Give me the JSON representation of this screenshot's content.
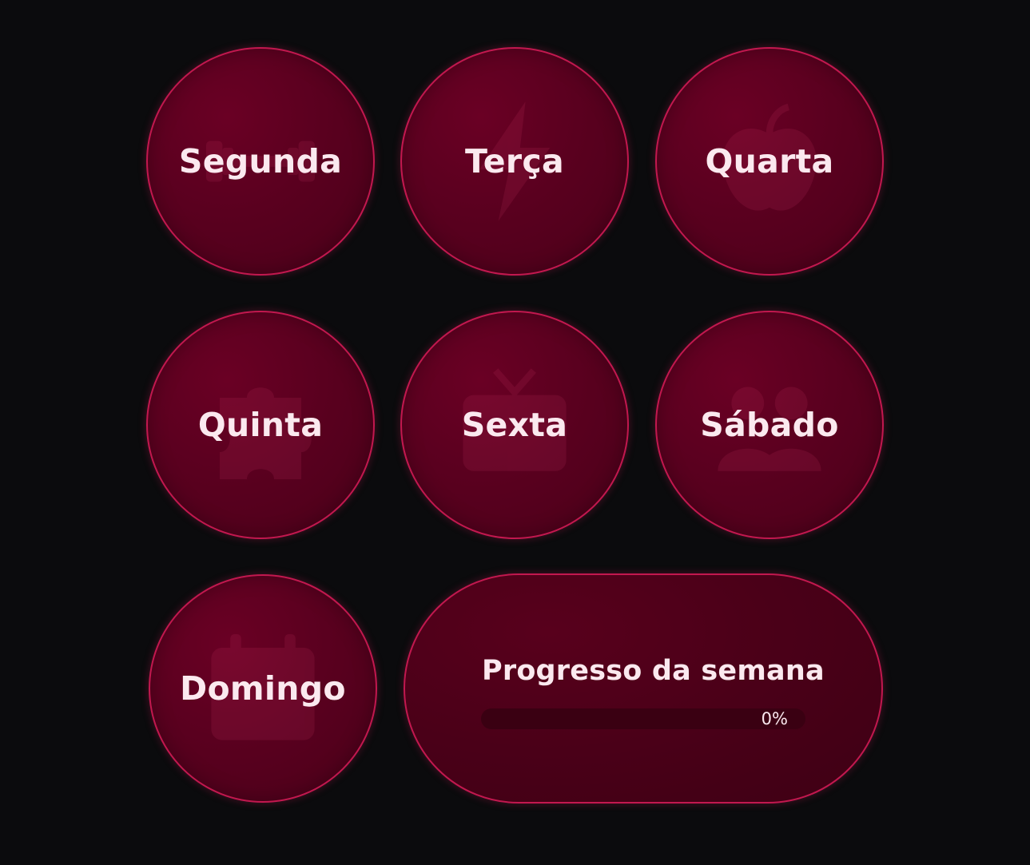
{
  "days": [
    {
      "label": "Segunda",
      "icon": "dumbbell-icon"
    },
    {
      "label": "Terça",
      "icon": "lightning-icon"
    },
    {
      "label": "Quarta",
      "icon": "apple-icon"
    },
    {
      "label": "Quinta",
      "icon": "puzzle-icon"
    },
    {
      "label": "Sexta",
      "icon": "tv-icon"
    },
    {
      "label": "Sábado",
      "icon": "group-icon"
    },
    {
      "label": "Domingo",
      "icon": "calendar-icon"
    }
  ],
  "progress": {
    "title": "Progresso da semana",
    "percent_text": "0%",
    "value": 0
  },
  "colors": {
    "background": "#0b0b0d",
    "card": "#5a001f",
    "accent": "#c2184f",
    "text": "#fbe9ef"
  }
}
